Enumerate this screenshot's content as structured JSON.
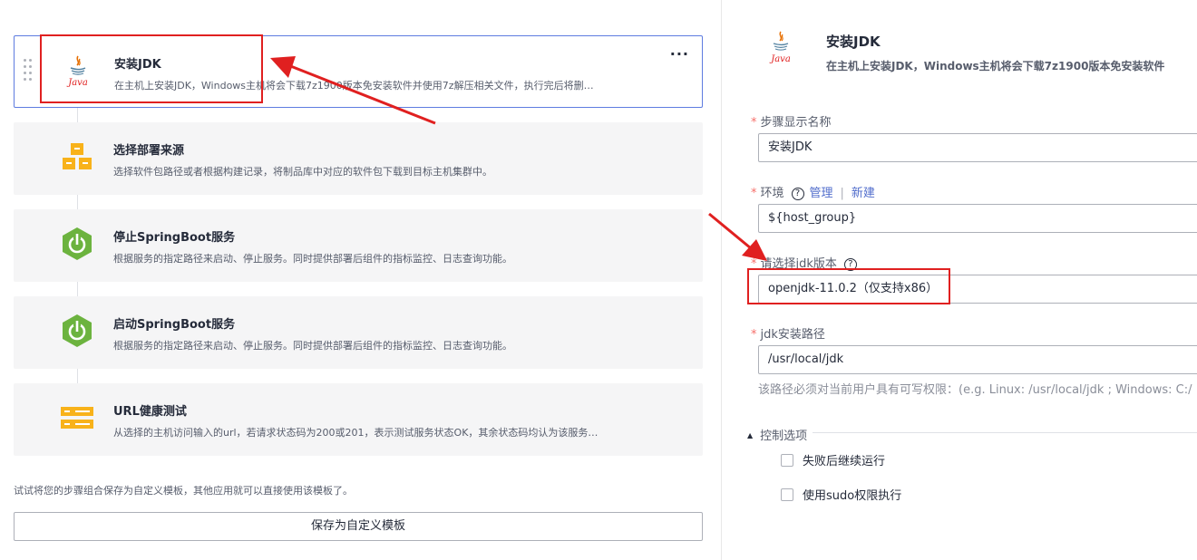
{
  "steps": [
    {
      "title": "安装JDK",
      "desc": "在主机上安装JDK，Windows主机将会下载7z1900版本免安装软件并使用7z解压相关文件，执行完后将删…",
      "icon": "java-icon"
    },
    {
      "title": "选择部署来源",
      "desc": "选择软件包路径或者根据构建记录，将制品库中对应的软件包下载到目标主机集群中。",
      "icon": "package-source-icon"
    },
    {
      "title": "停止SpringBoot服务",
      "desc": "根据服务的指定路径来启动、停止服务。同时提供部署后组件的指标监控、日志查询功能。",
      "icon": "springboot-icon"
    },
    {
      "title": "启动SpringBoot服务",
      "desc": "根据服务的指定路径来启动、停止服务。同时提供部署后组件的指标监控、日志查询功能。",
      "icon": "springboot-icon"
    },
    {
      "title": "URL健康测试",
      "desc": "从选择的主机访问输入的url，若请求状态码为200或201，表示测试服务状态OK，其余状态码均认为该服务…",
      "icon": "url-health-icon"
    }
  ],
  "more_label": "···",
  "hint": "试试将您的步骤组合保存为自定义模板，其他应用就可以直接使用该模板了。",
  "save_button": "保存为自定义模板",
  "detail": {
    "title": "安装JDK",
    "subtitle": "在主机上安装JDK，Windows主机将会下载7z1900版本免安装软件",
    "java_text": "Java",
    "name_label": "步骤显示名称",
    "name_value": "安装JDK",
    "env_label": "环境",
    "env_manage": "管理",
    "env_sep": "|",
    "env_new": "新建",
    "env_value": "${host_group}",
    "jdk_version_label": "请选择jdk版本",
    "jdk_version_value": "openjdk-11.0.2（仅支持x86）",
    "jdk_path_label": "jdk安装路径",
    "jdk_path_value": "/usr/local/jdk",
    "jdk_path_help": "该路径必须对当前用户具有可写权限：(e.g. Linux: /usr/local/jdk ; Windows: C:/",
    "control_label": "控制选项",
    "opt_continue": "失败后继续运行",
    "opt_sudo": "使用sudo权限执行",
    "required_mark": "*",
    "question_mark": "?"
  },
  "colors": {
    "active_border": "#5e7ce0",
    "annotation": "#e02020",
    "link": "#526ecc",
    "spring_green": "#6cb33f",
    "package_orange": "#f8b21a"
  }
}
